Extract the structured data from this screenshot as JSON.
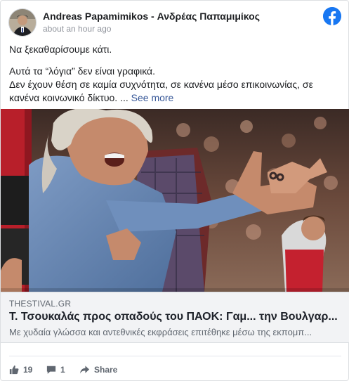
{
  "post": {
    "author": "Andreas Papamimikos - Ανδρέας Παπαμιμίκος",
    "timestamp": "about an hour ago",
    "text_line1": "Να ξεκαθαρίσουμε κάτι.",
    "text_line2": "Αυτά τα “λόγια” δεν είναι γραφικά.",
    "text_line3": "Δεν έχουν θέση σε καμία συχνότητα, σε κανένα μέσο επικοινωνίας, σε κανένα κοινωνικό δίκτυο. ...",
    "see_more": "See more"
  },
  "link": {
    "domain": "THESTIVAL.GR",
    "title": "Τ. Τσουκαλάς προς οπαδούς του ΠΑΟΚ: Γαμ... την Βουλγαρ...",
    "description": "Με χυδαία γλώσσα και αντεθνικές εκφράσεις επιτέθηκε μέσω της εκπομπ..."
  },
  "footer": {
    "likes": "19",
    "comments": "1",
    "share_label": "Share"
  },
  "colors": {
    "facebook_blue": "#1877f2",
    "link_blue": "#385898",
    "secondary_text": "#606770"
  },
  "icons": {
    "facebook": "facebook-logo-icon",
    "like": "thumbs-up-icon",
    "comment": "comment-bubble-icon",
    "share": "share-arrow-icon"
  }
}
